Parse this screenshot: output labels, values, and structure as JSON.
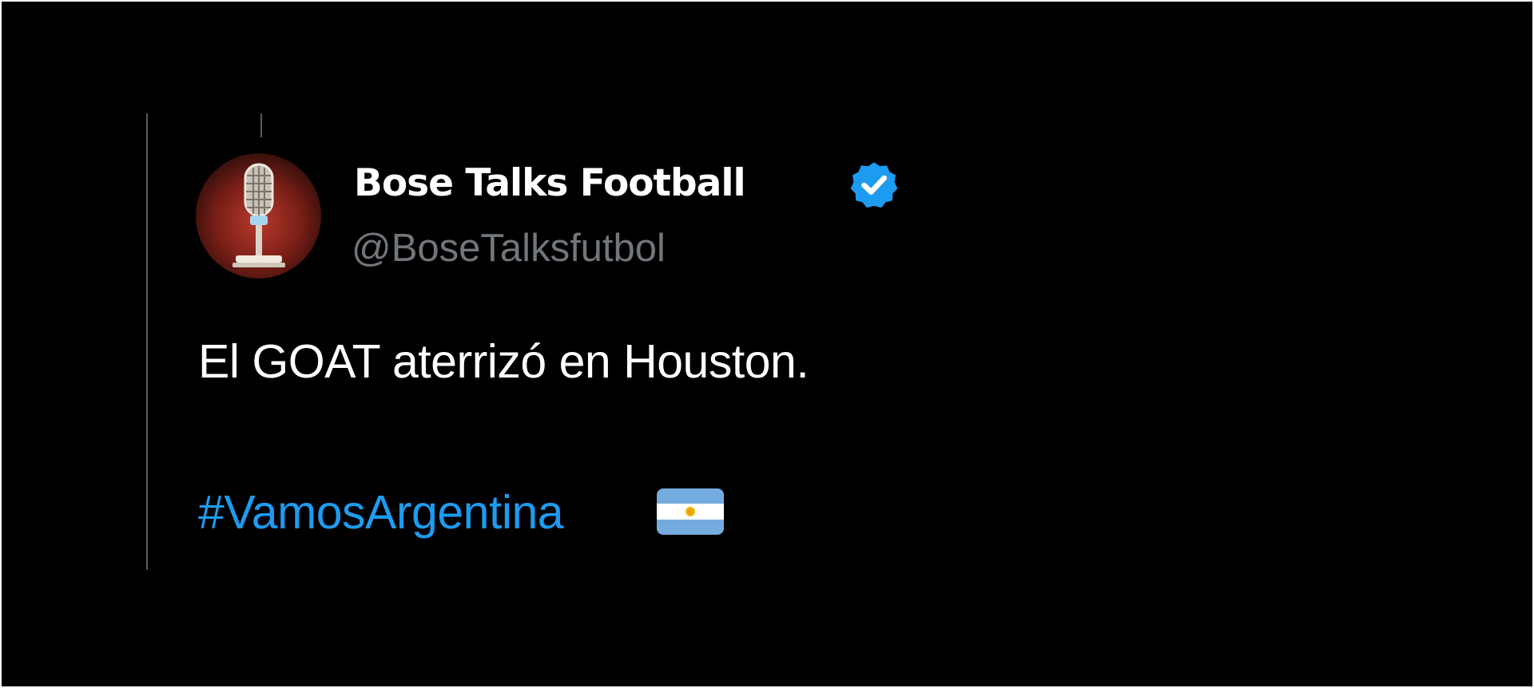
{
  "tweet": {
    "display_name": "Bose Talks Football",
    "handle": "@BoseTalksfutbol",
    "verified": true,
    "text": "El GOAT aterrizó en Houston.",
    "hashtag": "#VamosArgentina",
    "emoji": "argentina-flag-emoji",
    "avatar": "microphone-avatar"
  },
  "colors": {
    "background": "#000000",
    "text": "#ffffff",
    "handle": "#71767b",
    "link": "#1d9bf0",
    "verified": "#1d9bf0"
  }
}
